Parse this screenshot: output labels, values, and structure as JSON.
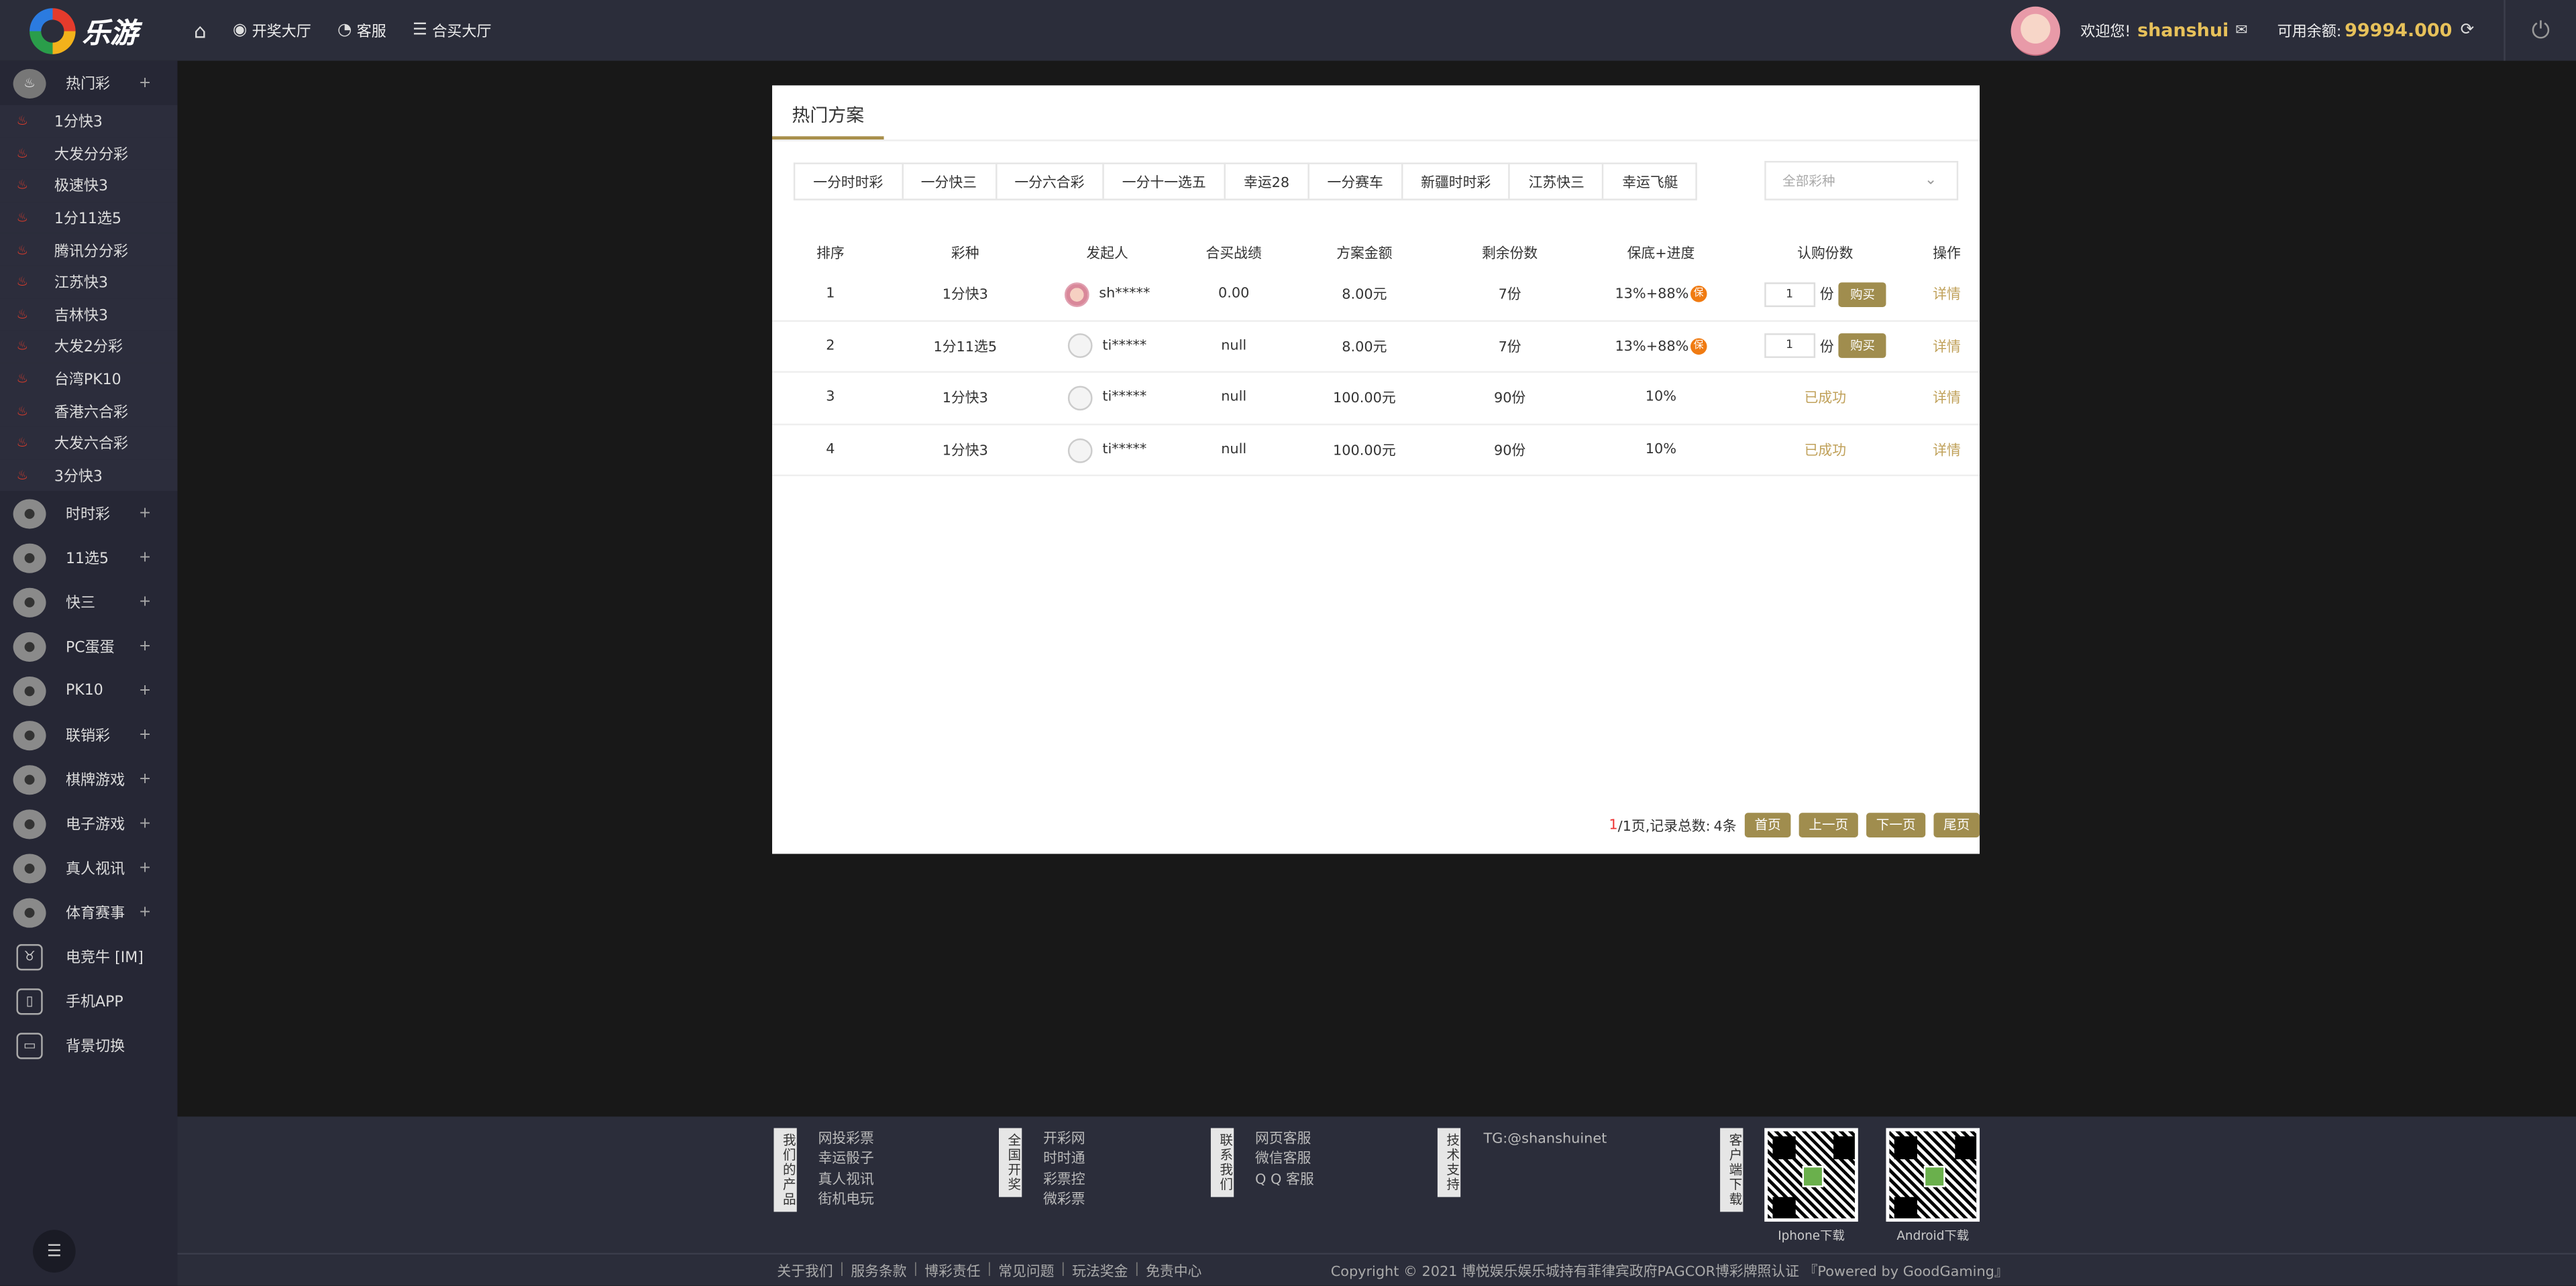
{
  "brand": {
    "name": "乐游"
  },
  "nav": [
    {
      "icon": "home-icon",
      "label": ""
    },
    {
      "icon": "lottery-icon",
      "label": "开奖大厅"
    },
    {
      "icon": "headset-icon",
      "label": "客服"
    },
    {
      "icon": "list-icon",
      "label": "合买大厅"
    }
  ],
  "user": {
    "welcome": "欢迎您!",
    "username": "shanshui",
    "balance_label": "可用余额:",
    "balance": "99994.000"
  },
  "sidebar": {
    "hot": {
      "label": "热门彩",
      "items": [
        "1分快3",
        "大发分分彩",
        "极速快3",
        "1分11选5",
        "腾讯分分彩",
        "江苏快3",
        "吉林快3",
        "大发2分彩",
        "台湾PK10",
        "香港六合彩",
        "大发六合彩",
        "3分快3"
      ]
    },
    "categories": [
      {
        "label": "时时彩",
        "icon": "ssc-icon",
        "expand": "+"
      },
      {
        "label": "11选5",
        "icon": "eleven-five-icon",
        "expand": "+"
      },
      {
        "label": "快三",
        "icon": "dice-icon",
        "expand": "+"
      },
      {
        "label": "PC蛋蛋",
        "icon": "pc-egg-icon",
        "expand": "+"
      },
      {
        "label": "PK10",
        "icon": "pk10-icon",
        "expand": "+"
      },
      {
        "label": "联销彩",
        "icon": "more-icon",
        "expand": "+"
      },
      {
        "label": "棋牌游戏",
        "icon": "cards-icon",
        "expand": "+"
      },
      {
        "label": "电子游戏",
        "icon": "slot-icon",
        "expand": "+"
      },
      {
        "label": "真人视讯",
        "icon": "person-icon",
        "expand": "+"
      },
      {
        "label": "体育赛事",
        "icon": "ball-icon",
        "expand": "+"
      },
      {
        "label": "电竞牛 [IM]",
        "icon": "bull-icon",
        "expand": ""
      },
      {
        "label": "手机APP",
        "icon": "phone-icon",
        "expand": ""
      },
      {
        "label": "背景切换",
        "icon": "monitor-icon",
        "expand": ""
      }
    ]
  },
  "panel": {
    "title": "热门方案",
    "tabs": [
      "一分时时彩",
      "一分快三",
      "一分六合彩",
      "一分十一选五",
      "幸运28",
      "一分赛车",
      "新疆时时彩",
      "江苏快三",
      "幸运飞艇"
    ],
    "select_placeholder": "全部彩种",
    "columns": [
      "排序",
      "彩种",
      "发起人",
      "合买战绩",
      "方案金额",
      "剩余份数",
      "保底+进度",
      "认购份数",
      "操作"
    ],
    "rows": [
      {
        "rank": "1",
        "lottery": "1分快3",
        "initiator": "sh*****",
        "record": "0.00",
        "amount": "8.00元",
        "remain": "7份",
        "progress": "13%+88%",
        "badge": "保",
        "qty": "1",
        "unit": "份",
        "buy": "购买",
        "status": "",
        "action": "详情"
      },
      {
        "rank": "2",
        "lottery": "1分11选5",
        "initiator": "ti*****",
        "record": "null",
        "amount": "8.00元",
        "remain": "7份",
        "progress": "13%+88%",
        "badge": "保",
        "qty": "1",
        "unit": "份",
        "buy": "购买",
        "status": "",
        "action": "详情"
      },
      {
        "rank": "3",
        "lottery": "1分快3",
        "initiator": "ti*****",
        "record": "null",
        "amount": "100.00元",
        "remain": "90份",
        "progress": "10%",
        "badge": "",
        "qty": "",
        "unit": "",
        "buy": "",
        "status": "已成功",
        "action": "详情"
      },
      {
        "rank": "4",
        "lottery": "1分快3",
        "initiator": "ti*****",
        "record": "null",
        "amount": "100.00元",
        "remain": "90份",
        "progress": "10%",
        "badge": "",
        "qty": "",
        "unit": "",
        "buy": "",
        "status": "已成功",
        "action": "详情"
      }
    ],
    "pager": {
      "current": "1",
      "total_text": "/1页,记录总数:",
      "count": "4条",
      "first": "首页",
      "prev": "上一页",
      "next": "下一页",
      "last": "尾页"
    }
  },
  "footer": {
    "sections": [
      {
        "tab": "我们的产品",
        "links": [
          "网投彩票",
          "幸运骰子",
          "真人视讯",
          "街机电玩"
        ]
      },
      {
        "tab": "全国开奖",
        "links": [
          "开彩网",
          "时时通",
          "彩票控",
          "微彩票"
        ]
      },
      {
        "tab": "联系我们",
        "links": [
          "网页客服",
          "微信客服",
          "Q Q 客服"
        ]
      },
      {
        "tab": "技术支持",
        "links": [
          "TG:@shanshuinet"
        ]
      },
      {
        "tab": "客户端下载",
        "links": []
      }
    ],
    "qr": [
      {
        "caption": "Iphone下载"
      },
      {
        "caption": "Android下载"
      }
    ],
    "bottom_links": [
      "关于我们",
      "服务条款",
      "博彩责任",
      "常见问题",
      "玩法奖金",
      "免责中心"
    ],
    "copyright": "Copyright © 2021 博悦娱乐娱乐城持有菲律宾政府PAGCOR博彩牌照认证 『Powered by GoodGaming』"
  },
  "colors": {
    "accent": "#a08d4e",
    "gold": "#e7c15a",
    "topbar": "#2b2d3a",
    "sidebar": "#262735",
    "background": "#181818"
  }
}
